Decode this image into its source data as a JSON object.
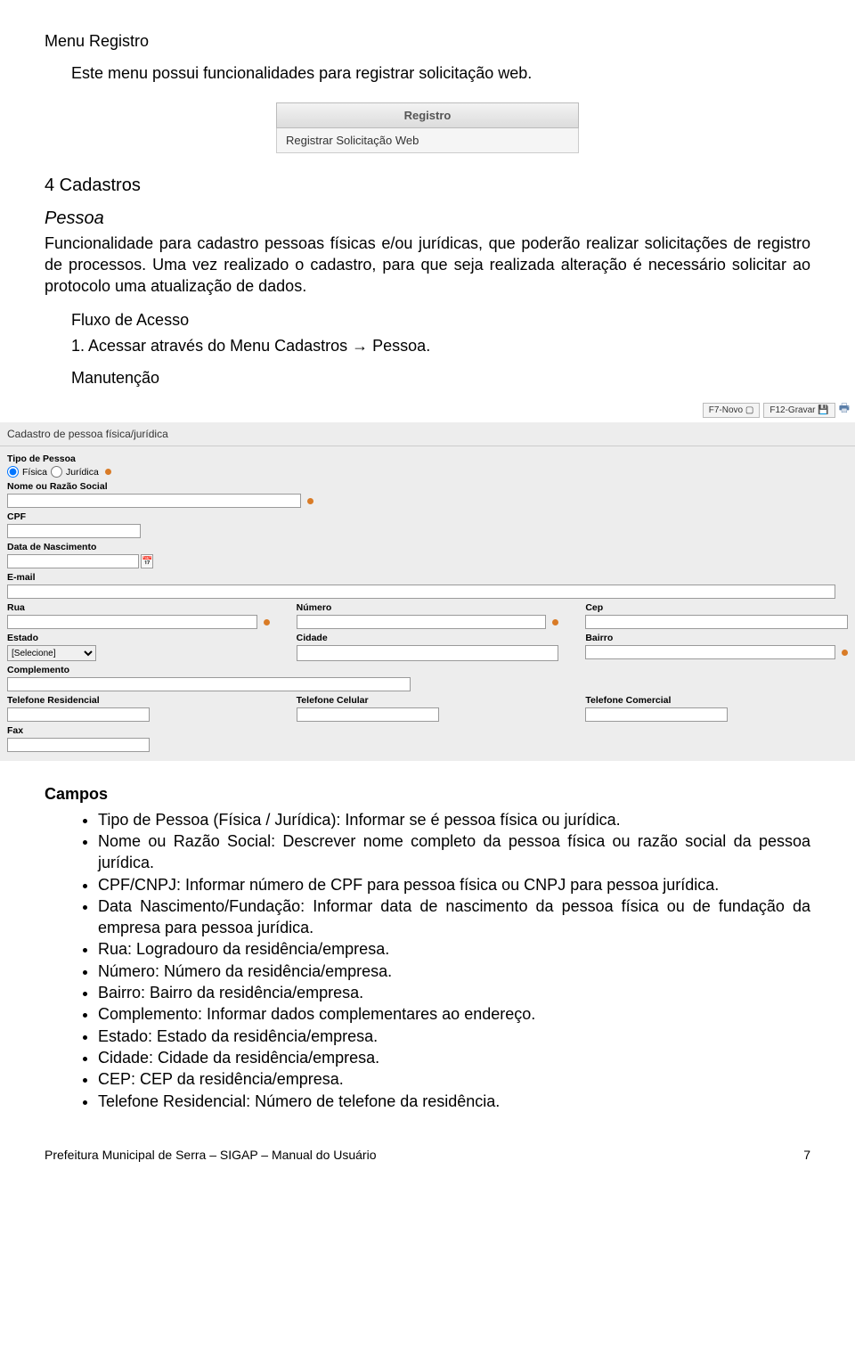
{
  "doc": {
    "menu_title": "Menu Registro",
    "menu_desc": "Este menu possui funcionalidades para registrar solicitação web.",
    "menubox": {
      "head": "Registro",
      "item": "Registrar Solicitação Web"
    },
    "sec4": "4  Cadastros",
    "pessoa_h": "Pessoa",
    "pessoa_p": "Funcionalidade para cadastro pessoas físicas e/ou jurídicas, que poderão realizar solicitações de registro de processos. Uma vez realizado o cadastro, para que seja realizada alteração é necessário solicitar ao protocolo uma atualização de dados.",
    "fluxo_h": "Fluxo de Acesso",
    "fluxo_1": "1.   Acessar através do Menu Cadastros → Pessoa.",
    "manut_h": "Manutenção",
    "campos_h": "Campos",
    "bullets": [
      "Tipo de Pessoa (Física / Jurídica): Informar se é pessoa física ou jurídica.",
      "Nome ou Razão Social: Descrever nome completo da pessoa física ou razão social da pessoa jurídica.",
      "CPF/CNPJ: Informar número de CPF para pessoa física ou CNPJ para pessoa jurídica.",
      "Data Nascimento/Fundação: Informar data de nascimento da pessoa física ou de fundação da empresa para pessoa jurídica.",
      "Rua: Logradouro da residência/empresa.",
      "Número: Número da residência/empresa.",
      "Bairro: Bairro da residência/empresa.",
      "Complemento: Informar dados complementares ao endereço.",
      "Estado: Estado da residência/empresa.",
      "Cidade: Cidade da residência/empresa.",
      "CEP: CEP da residência/empresa.",
      "Telefone Residencial: Número de telefone da residência."
    ],
    "footer_left": "Prefeitura Municipal de Serra – SIGAP – Manual do Usuário",
    "footer_right": "7"
  },
  "form": {
    "toolbar": {
      "novo": "F7-Novo",
      "gravar": "F12-Gravar"
    },
    "title": "Cadastro de pessoa física/jurídica",
    "labels": {
      "tipo": "Tipo de Pessoa",
      "fisica": "Física",
      "juridica": "Jurídica",
      "nome": "Nome ou Razão Social",
      "cpf": "CPF",
      "data": "Data de Nascimento",
      "email": "E-mail",
      "rua": "Rua",
      "numero": "Número",
      "cep": "Cep",
      "estado": "Estado",
      "estado_sel": "[Selecione]",
      "cidade": "Cidade",
      "bairro": "Bairro",
      "compl": "Complemento",
      "telr": "Telefone Residencial",
      "telc": "Telefone Celular",
      "telcom": "Telefone Comercial",
      "fax": "Fax"
    }
  }
}
